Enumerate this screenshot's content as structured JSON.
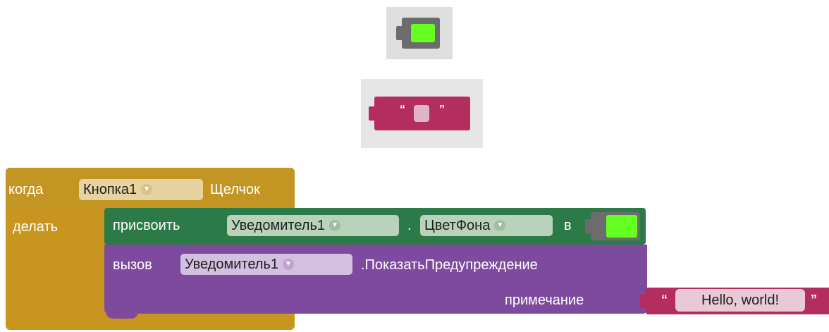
{
  "colors": {
    "event_block": "#c8961f",
    "set_block": "#2c7a47",
    "call_block": "#7e4a9e",
    "text_block": "#b32d5e",
    "color_value": "#66ff22",
    "color_block": "#6c6c6c"
  },
  "preview": {
    "text_open_quote": "“",
    "text_close_quote": "”"
  },
  "event": {
    "when_label": "когда",
    "component": "Кнопка1",
    "event_name": "Щелчок",
    "do_label": "делать"
  },
  "set_statement": {
    "set_label": "присвоить",
    "component": "Уведомитель1",
    "dot": ".",
    "property": "ЦветФона",
    "to_label": "в"
  },
  "call_statement": {
    "call_label": "вызов",
    "component": "Уведомитель1",
    "method": ".ПоказатьПредупреждение",
    "param_label": "примечание"
  },
  "text_value": {
    "open_quote": "“",
    "value": "Hello, world!",
    "close_quote": "”"
  },
  "icons": {
    "dropdown": "chevron-down-icon"
  }
}
